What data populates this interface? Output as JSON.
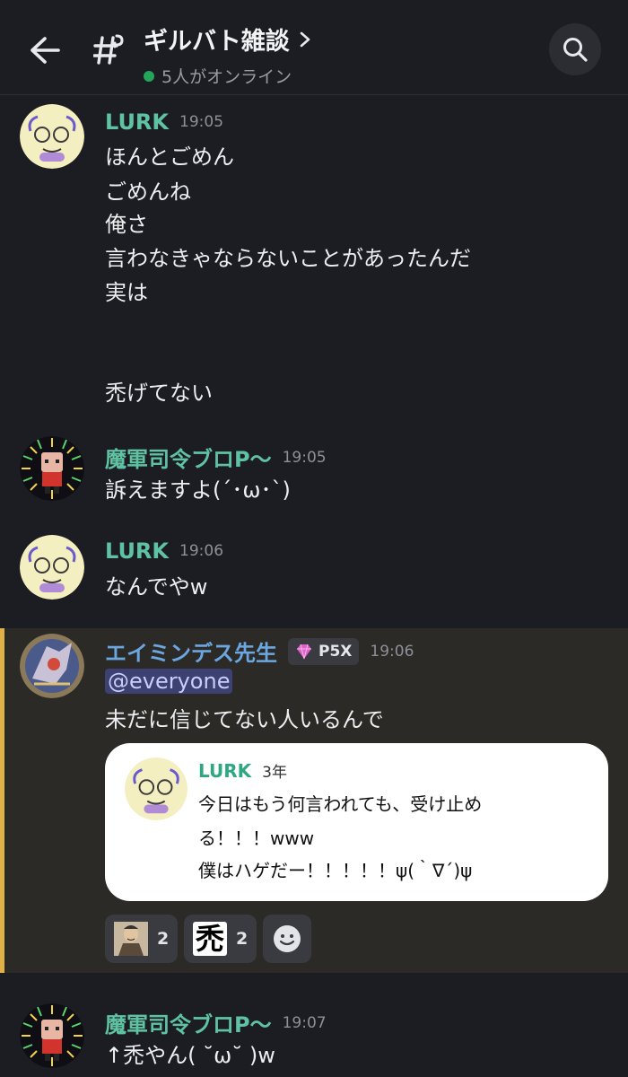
{
  "header": {
    "title": "ギルバト雑談",
    "online": "5人がオンライン"
  },
  "messages": [
    {
      "author": "LURK",
      "time": "19:05",
      "lines": [
        "ほんとごめん",
        "ごめんね",
        "俺さ",
        "言わなきゃならないことがあったんだ",
        "実は",
        "禿げてない"
      ]
    },
    {
      "author": "魔軍司令ブロP～",
      "time": "19:05",
      "lines": [
        "訴えますよ(´･ω･`)"
      ]
    },
    {
      "author": "LURK",
      "time": "19:06",
      "lines": [
        "なんでやw"
      ]
    },
    {
      "author": "エイミンデス先生",
      "badge": "P5X",
      "time": "19:06",
      "mention": "@everyone",
      "lines": [
        "未だに信じてない人いるんで"
      ],
      "embed": {
        "author": "LURK",
        "time": "3年",
        "lines": [
          "今日はもう何言われても、受け止め",
          "る！！！www",
          "僕はハゲだー！！！！！ψ(｀∇´)ψ"
        ]
      },
      "reactions": [
        {
          "emoji": "samurai-portrait",
          "count": "2"
        },
        {
          "emoji": "禿",
          "count": "2"
        }
      ]
    },
    {
      "author": "魔軍司令ブロP～",
      "time": "19:07",
      "lines": [
        "↑禿やん( ˘ω˘ )w"
      ]
    }
  ],
  "colors": {
    "background": "#1c1d22",
    "author_green": "#5fc2a3",
    "author_blue": "#6ba6e0",
    "highlight": "#2b2a26",
    "highlight_bar": "#e0b245",
    "online": "#23a55a"
  }
}
